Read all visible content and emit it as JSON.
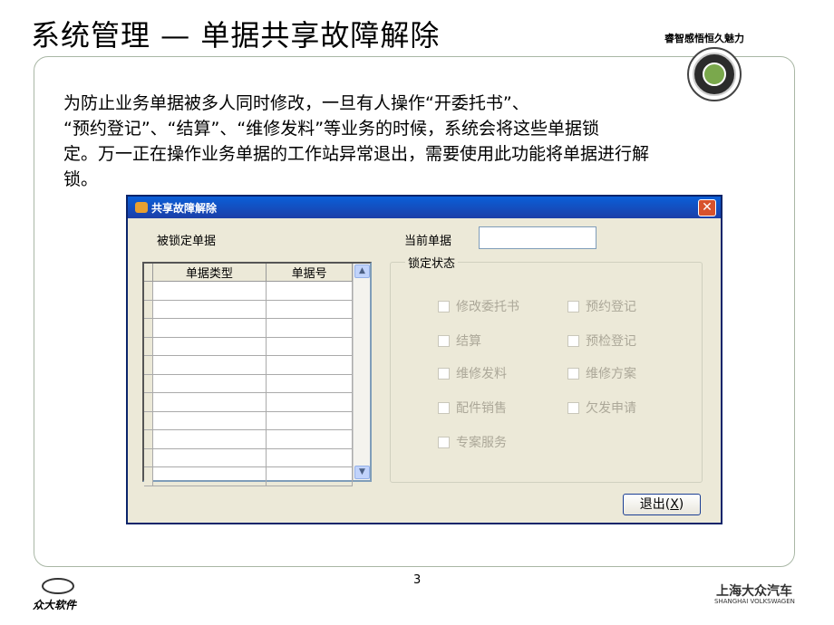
{
  "slide": {
    "title": "系统管理 — 单据共享故障解除",
    "slogan": "睿智感悟恒久魅力",
    "paragraph": [
      "为防止业务单据被多人同时修改，一旦有人操作“开委托书”、",
      "“预约登记”、“结算”、“维修发料”等业务的时候，系统会将这些单据锁",
      "定。万一正在操作业务单据的工作站异常退出，需要使用此功能将单据进行解",
      "锁。"
    ],
    "page_number": "3",
    "footer_left": "众大软件",
    "footer_right_cn": "上海大众汽车",
    "footer_right_en": "SHANGHAI VOLKSWAGEN"
  },
  "dialog": {
    "title": "共享故障解除",
    "close_label": "✕",
    "locked_label": "被锁定单据",
    "columns": [
      "单据类型",
      "单据号"
    ],
    "current_label": "当前单据",
    "current_value": "",
    "group_label": "锁定状态",
    "checkboxes": {
      "c1": "修改委托书",
      "c2": "预约登记",
      "c3": "结算",
      "c4": "预检登记",
      "c5": "维修发料",
      "c6": "维修方案",
      "c7": "配件销售",
      "c8": "欠发申请",
      "c9": "专案服务"
    },
    "exit_label": "退出(",
    "exit_key": "X",
    "exit_close": ")"
  },
  "icons": {
    "scroll_up": "▲",
    "scroll_down": "▼"
  }
}
